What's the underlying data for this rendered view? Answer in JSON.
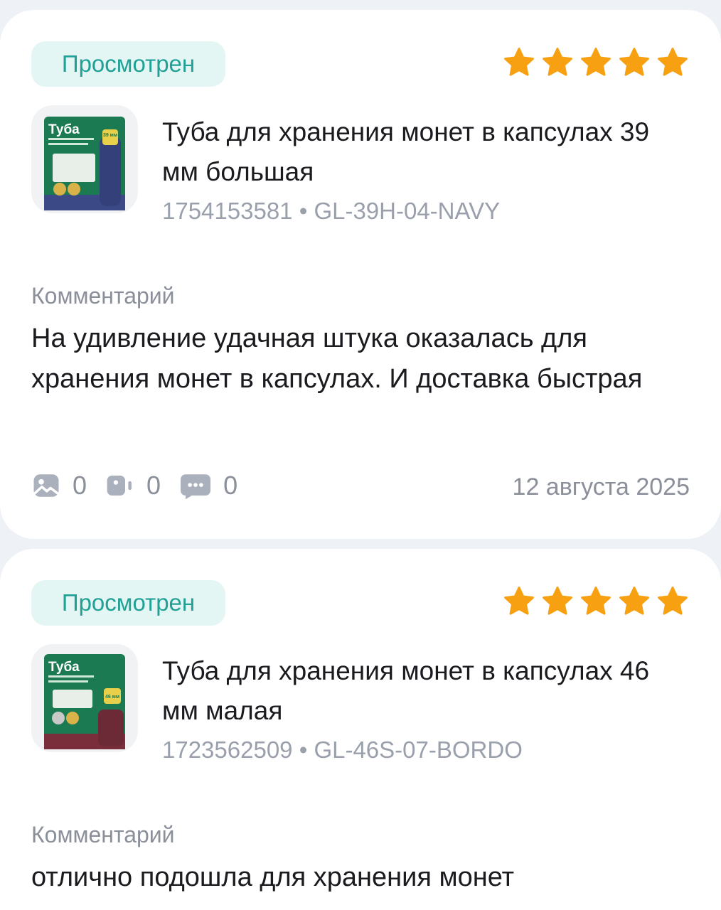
{
  "reviews": [
    {
      "status": "Просмотрен",
      "rating": 5,
      "product": {
        "thumb_label": "Туба",
        "thumb_size": "39 мм",
        "thumb_color": "#3a4a8c",
        "title": "Туба для хранения монет в капсулах 39 мм большая",
        "id": "1754153581",
        "separator": "•",
        "sku": "GL-39H-04-NAVY"
      },
      "comment_label": "Комментарий",
      "comment": "На удивление удачная штука оказалась для хранения монет в капсулах. И доставка быстрая",
      "counters": {
        "photos": "0",
        "videos": "0",
        "comments": "0"
      },
      "date": "12 августа 2025"
    },
    {
      "status": "Просмотрен",
      "rating": 5,
      "product": {
        "thumb_label": "Туба",
        "thumb_size": "46 мм",
        "thumb_color": "#6b2a36",
        "title": "Туба для хранения монет в капсулах 46 мм малая",
        "id": "1723562509",
        "separator": "•",
        "sku": "GL-46S-07-BORDO"
      },
      "comment_label": "Комментарий",
      "comment": "отлично подошла для хранения монет"
    }
  ],
  "colors": {
    "star": "#f7a112",
    "badge_bg": "#e3f6f4",
    "badge_text": "#21a096",
    "box_green": "#1b7a52"
  },
  "icons": [
    "star-icon",
    "photo-icon",
    "video-icon",
    "comment-icon"
  ]
}
